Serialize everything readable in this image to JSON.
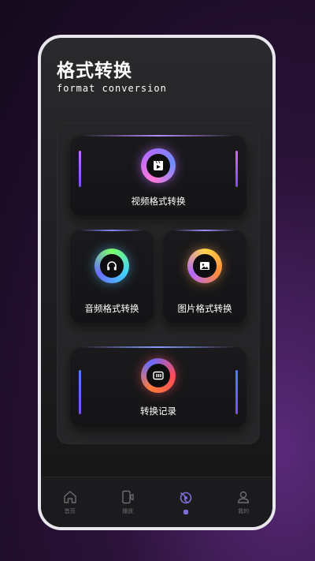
{
  "header": {
    "title": "格式转换",
    "subtitle": "format conversion"
  },
  "cards": {
    "video": {
      "label": "视频格式转换",
      "icon": "video-file-icon"
    },
    "audio": {
      "label": "音频格式转换",
      "icon": "headphones-icon"
    },
    "image": {
      "label": "图片格式转换",
      "icon": "image-icon"
    },
    "record": {
      "label": "转换记录",
      "icon": "record-list-icon"
    }
  },
  "tabbar": {
    "items": [
      {
        "label": "首页",
        "icon": "home-icon"
      },
      {
        "label": "播放",
        "icon": "phone-video-icon"
      },
      {
        "label": "",
        "icon": "swirl-icon",
        "active": true
      },
      {
        "label": "我的",
        "icon": "person-icon"
      }
    ]
  },
  "colors": {
    "accent": "#7e6cd6",
    "background": "#1c1c1e"
  }
}
